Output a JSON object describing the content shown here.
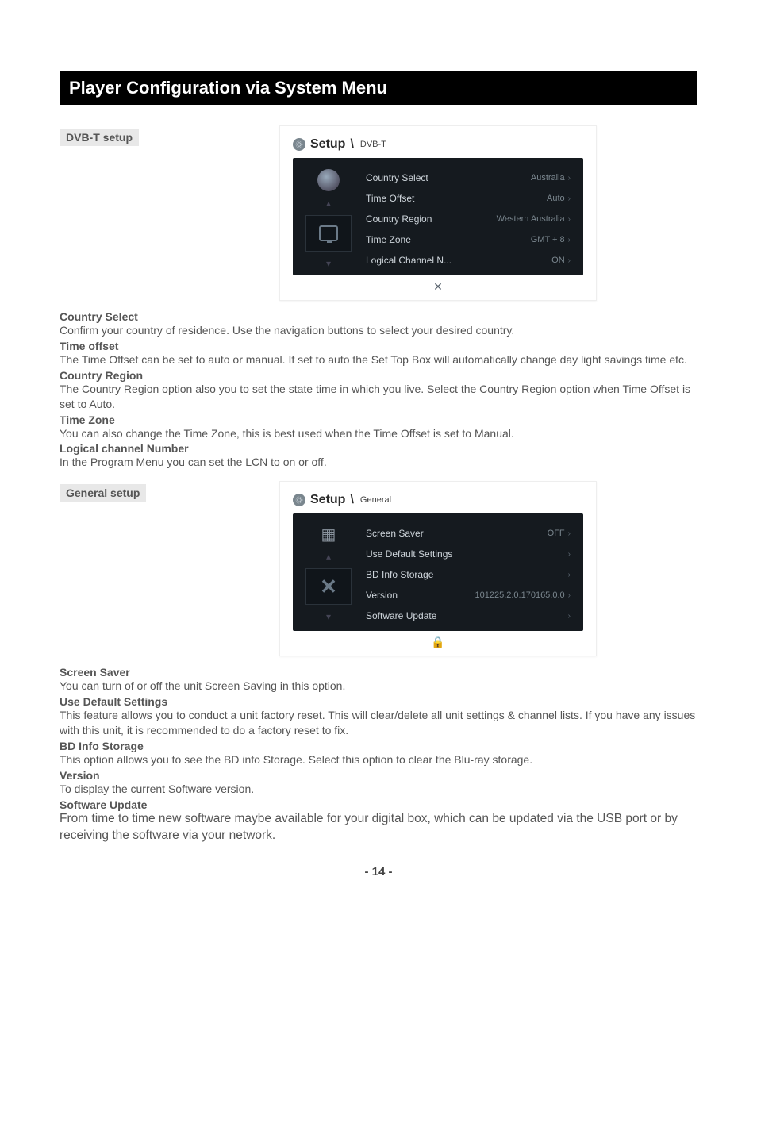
{
  "title": "Player Configuration via System Menu",
  "section1": {
    "chip": "DVB-T setup",
    "shot": {
      "crumb_main": "Setup",
      "crumb_sub": "DVB-T",
      "rows": [
        {
          "label": "Country Select",
          "value": "Australia"
        },
        {
          "label": "Time Offset",
          "value": "Auto"
        },
        {
          "label": "Country Region",
          "value": "Western Australia"
        },
        {
          "label": "Time Zone",
          "value": "GMT + 8"
        },
        {
          "label": "Logical Channel N...",
          "value": "ON"
        }
      ]
    },
    "items": [
      {
        "h": "Country Select",
        "p": "Confirm your country of residence. Use the navigation buttons to select your desired country."
      },
      {
        "h": "Time offset",
        "p": "The Time Offset can be set to auto or manual. If set to auto the Set Top Box will automatically change day light savings time etc."
      },
      {
        "h": "Country Region",
        "p": "The Country Region option also you to set the state time in which you live. Select the Country Region option when Time Offset is set to Auto."
      },
      {
        "h": "Time Zone",
        "p": "You can also change the Time Zone, this is best used when the Time Offset is set to Manual."
      },
      {
        "h": "Logical channel Number",
        "p": "In the Program Menu you can set the LCN to on or off."
      }
    ]
  },
  "section2": {
    "chip": "General setup",
    "shot": {
      "crumb_main": "Setup",
      "crumb_sub": "General",
      "rows": [
        {
          "label": "Screen Saver",
          "value": "OFF"
        },
        {
          "label": "Use Default Settings",
          "value": ""
        },
        {
          "label": "BD Info Storage",
          "value": ""
        },
        {
          "label": "Version",
          "value": "101225.2.0.170165.0.0"
        },
        {
          "label": "Software Update",
          "value": ""
        }
      ]
    },
    "items": [
      {
        "h": "Screen Saver",
        "p": "You can turn of or off the unit Screen Saving in this option."
      },
      {
        "h": "Use Default  Settings",
        "p": "This feature allows you to conduct a unit factory reset. This will clear/delete all unit settings & channel lists. If you have any issues with this unit, it is recommended to do a factory reset to fix."
      },
      {
        "h": "BD Info Storage",
        "p": "This option allows you to see the BD info Storage. Select this option to clear the Blu-ray storage."
      },
      {
        "h": "Version",
        "p": "To display the current Software version."
      },
      {
        "h": "Software Update",
        "p": "From time to time new software maybe available for your digital box, which can be updated via the USB port or by receiving the software via your network."
      }
    ]
  },
  "page_number": "- 14 -"
}
